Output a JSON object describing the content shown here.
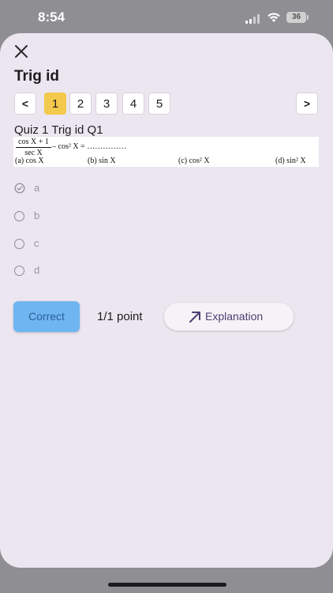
{
  "status_bar": {
    "time": "8:54",
    "battery": "36"
  },
  "sheet": {
    "title": "Trig id",
    "pagination": {
      "prev": "<",
      "next": ">",
      "pages": [
        "1",
        "2",
        "3",
        "4",
        "5"
      ],
      "active_page": "1"
    },
    "question": {
      "title": "Quiz 1 Trig id Q1",
      "formula": {
        "numerator": "cos X + 1",
        "denominator": "sec X",
        "expression": "– cos² X = ……………",
        "choices": [
          "(a) cos X",
          "(b) sin X",
          "(c) cos² X",
          "(d) sin² X"
        ]
      },
      "options": [
        "a",
        "b",
        "c",
        "d"
      ],
      "selected": "a"
    },
    "result": {
      "status_button": "Correct",
      "points": "1/1 point",
      "explanation_button": "Explanation"
    }
  },
  "colors": {
    "sheet_bg": "#ece6f0",
    "active_page": "#f2c94c",
    "correct_button": "#6fb5f2",
    "explanation_text": "#4b3f72"
  }
}
